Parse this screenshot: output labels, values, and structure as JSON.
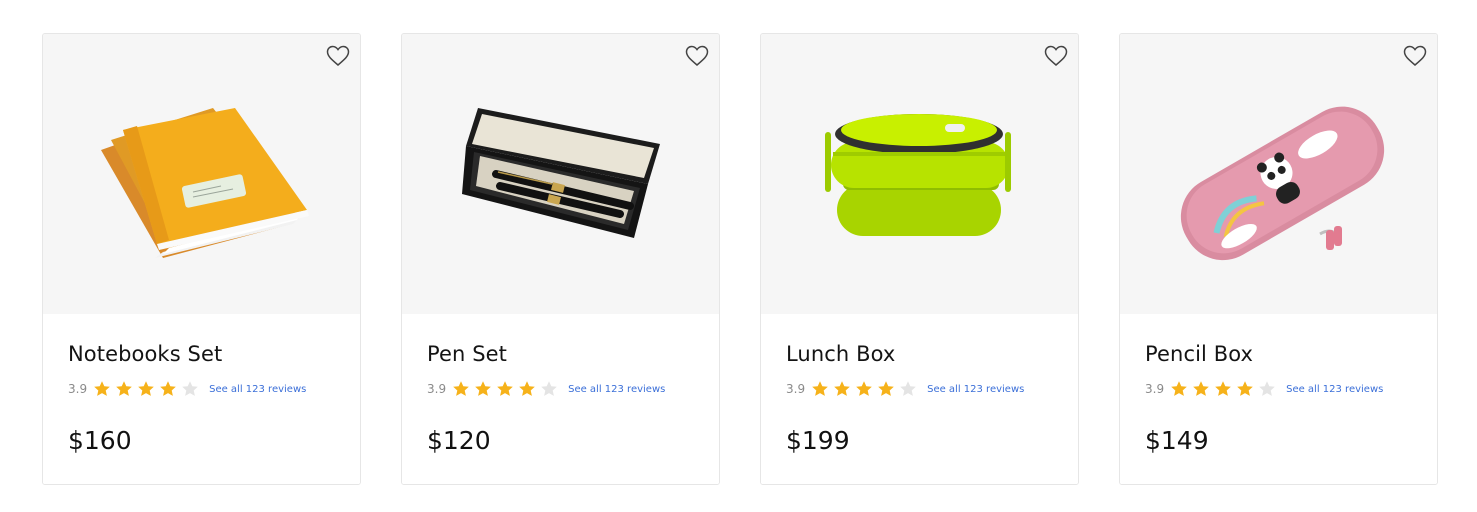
{
  "colors": {
    "star_filled": "#f6b21a",
    "star_empty": "#e4e4e4",
    "link": "#3b6fd8",
    "image_bg": "#f6f6f6"
  },
  "products": [
    {
      "name": "Notebooks Set",
      "rating": "3.9",
      "stars_filled": 4,
      "stars_total": 5,
      "reviews_link": "See all 123 reviews",
      "price": "$160",
      "image": "notebooks-image",
      "wishlist_icon": "heart-outline-icon"
    },
    {
      "name": "Pen Set",
      "rating": "3.9",
      "stars_filled": 4,
      "stars_total": 5,
      "reviews_link": "See all 123 reviews",
      "price": "$120",
      "image": "pen-set-image",
      "wishlist_icon": "heart-outline-icon"
    },
    {
      "name": "Lunch Box",
      "rating": "3.9",
      "stars_filled": 4,
      "stars_total": 5,
      "reviews_link": "See all 123 reviews",
      "price": "$199",
      "image": "lunch-box-image",
      "wishlist_icon": "heart-outline-icon"
    },
    {
      "name": "Pencil Box",
      "rating": "3.9",
      "stars_filled": 4,
      "stars_total": 5,
      "reviews_link": "See all 123 reviews",
      "price": "$149",
      "image": "pencil-box-image",
      "wishlist_icon": "heart-outline-icon"
    }
  ]
}
